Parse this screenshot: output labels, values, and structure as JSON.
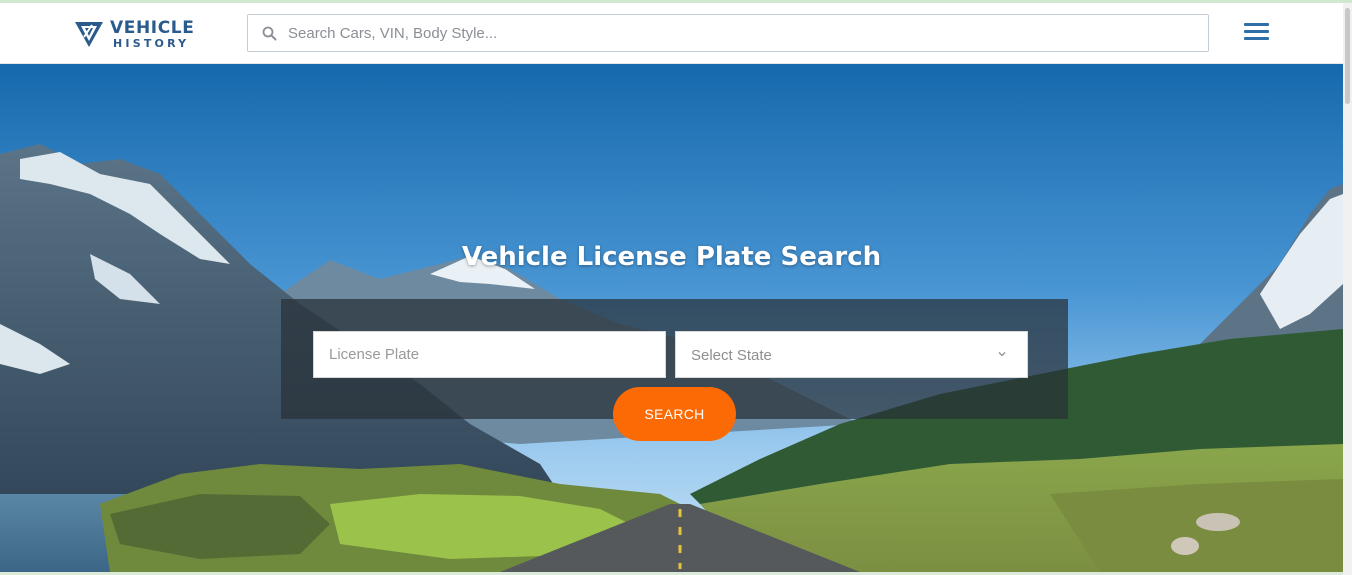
{
  "header": {
    "logo": {
      "word1": "VEHICLE",
      "word2": "HISTORY",
      "icon": "vehicle-history-logo-mark"
    },
    "search": {
      "placeholder": "Search Cars, VIN, Body Style...",
      "value": "",
      "icon": "search-icon"
    },
    "menu": {
      "icon": "hamburger-menu-icon"
    }
  },
  "hero": {
    "title": "Vehicle License Plate Search",
    "plate_input": {
      "placeholder": "License Plate",
      "value": ""
    },
    "state_select": {
      "selected": "Select State",
      "icon": "chevron-down-icon"
    },
    "search_button": {
      "label": "SEARCH"
    }
  },
  "colors": {
    "brand_blue": "#2b5a8c",
    "accent_orange": "#fb6a04",
    "panel_overlay": "#283038"
  }
}
